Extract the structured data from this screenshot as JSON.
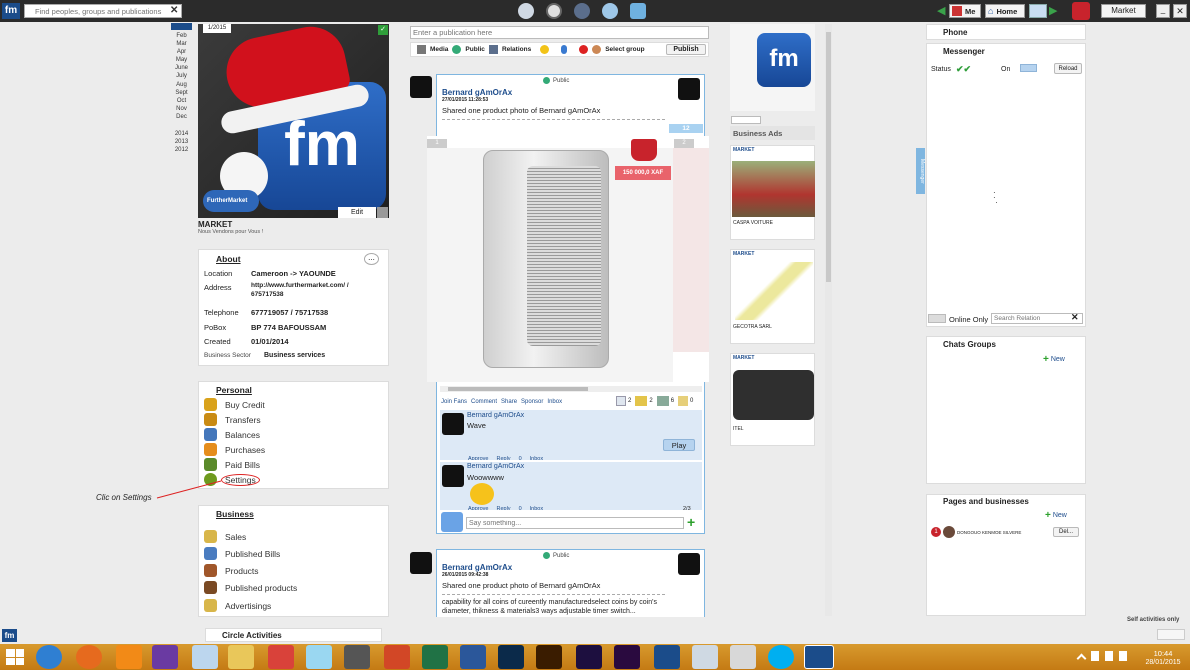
{
  "app": {
    "logo": "fm",
    "search_placeholder": "Find peoples, groups and publications",
    "market_label": "Market"
  },
  "topnav": {
    "me": "Me",
    "home": "Home"
  },
  "timeline": {
    "months": [
      "Feb",
      "Mar",
      "Apr",
      "May",
      "June",
      "July",
      "Aug",
      "Sept",
      "Oct",
      "Nov",
      "Dec"
    ],
    "years": [
      "2014",
      "2013",
      "2012"
    ]
  },
  "profile": {
    "photo_badge": "1/2015",
    "edit_label": "Edit",
    "name": "MARKET",
    "tagline": "Nous Vendons pour Vous !",
    "logo_text": "fm",
    "brand_text": "FurtherMarket"
  },
  "about": {
    "title": "About",
    "more": "...",
    "rows": [
      {
        "label": "Location",
        "value": "Cameroon -> YAOUNDE"
      },
      {
        "label": "Address",
        "value": "http://www.furthermarket.com/ / 675717538"
      },
      {
        "label": "Telephone",
        "value": "677719057 / 75717538"
      },
      {
        "label": "PoBox",
        "value": "BP 774 BAFOUSSAM"
      },
      {
        "label": "Created",
        "value": "01/01/2014"
      },
      {
        "label": "Business Sector",
        "value": "Business services"
      }
    ]
  },
  "personal": {
    "title": "Personal",
    "items": [
      {
        "label": "Buy Credit",
        "icon": "coins-icon",
        "color": "#d9a21b"
      },
      {
        "label": "Transfers",
        "icon": "transfer-icon",
        "color": "#c98b14"
      },
      {
        "label": "Balances",
        "icon": "balance-icon",
        "color": "#4477bb"
      },
      {
        "label": "Purchases",
        "icon": "basket-icon",
        "color": "#e58d1c"
      },
      {
        "label": "Paid Bills",
        "icon": "bill-icon",
        "color": "#5a8a2a"
      },
      {
        "label": "Settings",
        "icon": "gear-icon",
        "color": "#6e9a1e"
      }
    ]
  },
  "annotation": "Clic on Settings",
  "business": {
    "title": "Business",
    "items": [
      {
        "label": "Sales",
        "icon": "sales-icon",
        "color": "#d8b64a"
      },
      {
        "label": "Published Bills",
        "icon": "bills-icon",
        "color": "#4a7cc0"
      },
      {
        "label": "Products",
        "icon": "products-icon",
        "color": "#a0562a"
      },
      {
        "label": "Published products",
        "icon": "published-icon",
        "color": "#7a4a24"
      },
      {
        "label": "Advertisings",
        "icon": "ads-icon",
        "color": "#d8b64a"
      }
    ]
  },
  "circle": {
    "title": "Circle Activities"
  },
  "composer": {
    "placeholder": "Enter a publication here",
    "media": "Media",
    "public": "Public",
    "relations": "Relations",
    "select_group": "Select group",
    "publish": "Publish"
  },
  "post1": {
    "visibility": "Public",
    "author": "Bernard gAmOrAx",
    "date": "27/01/2015 11:28:53",
    "text": "Shared one product photo of  Bernard gAmOrAx",
    "photo_count": "12",
    "slide_left": "1",
    "slide_right": "2",
    "price": "150 000,0 XAF",
    "actions": [
      "Join Fans",
      "Comment",
      "Share",
      "Sponsor",
      "Inbox"
    ],
    "counts": [
      "2",
      "2",
      "6",
      "0"
    ],
    "comments": [
      {
        "author": "Bernard gAmOrAx",
        "text": "Wave",
        "play": "Play",
        "meta": [
          "Approve",
          "Reply",
          "0",
          "Inbox"
        ]
      },
      {
        "author": "Bernard gAmOrAx",
        "text": "Woowwww",
        "meta": [
          "Approve",
          "Reply",
          "0",
          "Inbox"
        ]
      }
    ],
    "comment_pager": "2/3",
    "comment_placeholder": "Say something..."
  },
  "post2": {
    "visibility": "Public",
    "author": "Bernard gAmOrAx",
    "date": "26/01/2015 09:42:38",
    "text": "Shared one product photo of  Bernard gAmOrAx",
    "desc": "capability for all coins of cureently manufacturedselect coins by coin's diameter, thikness & materials3 ways adjustable timer switch..."
  },
  "ads": {
    "title": "Business Ads",
    "items": [
      {
        "tag": "MARKET",
        "caption": "CASPA VOITURE"
      },
      {
        "tag": "MARKET",
        "caption": "GECOTRA SARL"
      },
      {
        "tag": "MARKET",
        "caption": "ITEL"
      }
    ]
  },
  "right": {
    "phone": "Phone",
    "messenger": "Messenger",
    "status_label": "Status",
    "on_label": "On",
    "reload": "Reload",
    "messenger_tab": "Messenger",
    "online_only": "Online Only",
    "search_relation": "Search Relation",
    "chats_groups": "Chats Groups",
    "new_label": "New",
    "pages": "Pages and businesses",
    "page_item": "DONGOUO KENMOE SILVERE",
    "page_badge": "1",
    "delete": "Del...",
    "self_activities": "Self activities only"
  },
  "clock": {
    "time": "10:44",
    "date": "28/01/2015"
  }
}
